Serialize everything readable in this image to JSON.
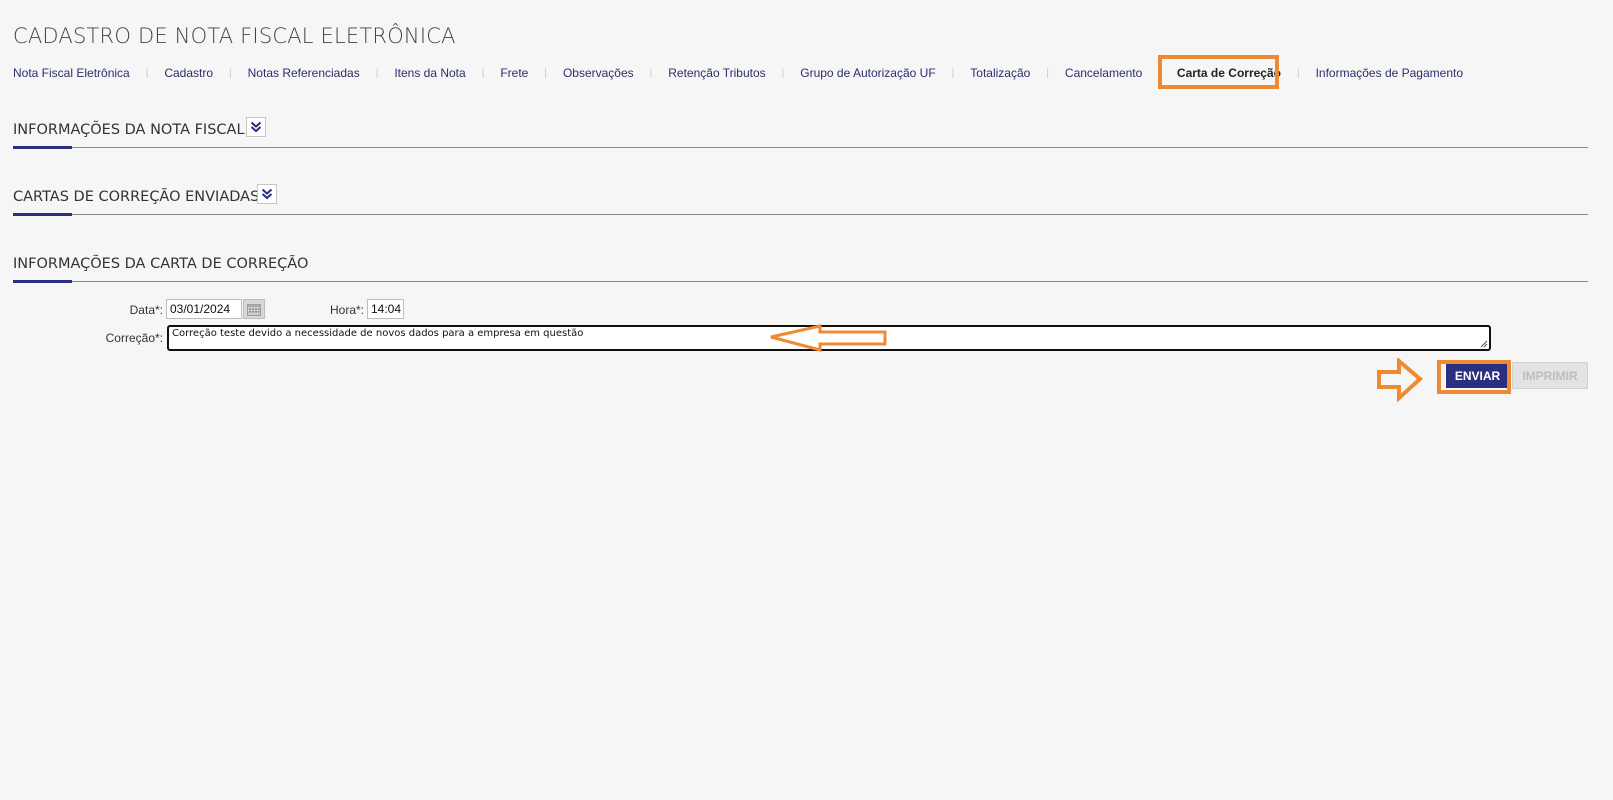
{
  "page": {
    "title": "CADASTRO DE NOTA FISCAL ELETRÔNICA"
  },
  "tabs": [
    {
      "label": "Nota Fiscal Eletrônica",
      "active": false
    },
    {
      "label": "Cadastro",
      "active": false
    },
    {
      "label": "Notas Referenciadas",
      "active": false
    },
    {
      "label": "Itens da Nota",
      "active": false
    },
    {
      "label": "Frete",
      "active": false
    },
    {
      "label": "Observações",
      "active": false
    },
    {
      "label": "Retenção Tributos",
      "active": false
    },
    {
      "label": "Grupo de Autorização UF",
      "active": false
    },
    {
      "label": "Totalização",
      "active": false
    },
    {
      "label": "Cancelamento",
      "active": false
    },
    {
      "label": "Carta de Correção",
      "active": true
    },
    {
      "label": "Informações de Pagamento",
      "active": false
    }
  ],
  "sections": {
    "nota_fiscal": {
      "title": "INFORMAÇÕES DA NOTA FISCAL"
    },
    "cartas_enviadas": {
      "title": "CARTAS DE CORREÇÃO ENVIADAS"
    },
    "carta_info": {
      "title": "INFORMAÇÕES DA CARTA DE CORREÇÃO"
    }
  },
  "form": {
    "data_label": "Data*:",
    "data_value": "03/01/2024",
    "hora_label": "Hora*:",
    "hora_value": "14:04",
    "correcao_label": "Correção*:",
    "correcao_value": "Correção teste devido a necessidade de novos dados para a empresa em questão"
  },
  "buttons": {
    "enviar": "ENVIAR",
    "imprimir": "IMPRIMIR"
  },
  "colors": {
    "accent": "#2b2f80",
    "annotation": "#f08a32",
    "background": "#f6f6f6"
  },
  "icons": {
    "section_toggle": "double-chevron-down-icon",
    "calendar": "calendar-icon"
  }
}
